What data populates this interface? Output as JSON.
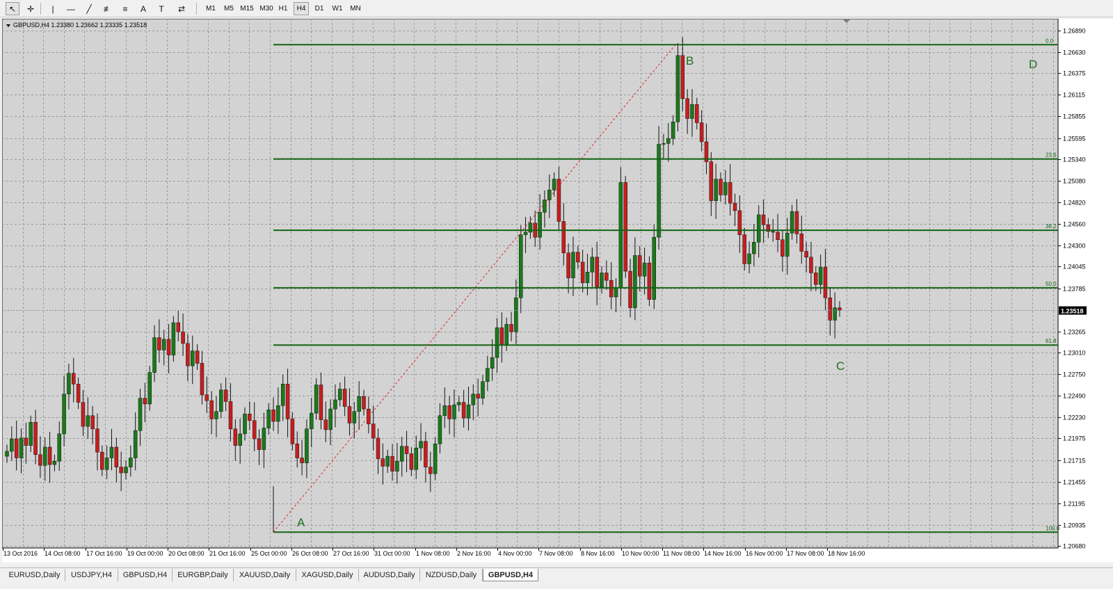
{
  "toolbar": {
    "tools": [
      {
        "name": "cursor-icon",
        "glyph": "↖"
      },
      {
        "name": "crosshair-icon",
        "glyph": "✛"
      },
      {
        "name": "vertical-line-icon",
        "glyph": "|"
      },
      {
        "name": "horizontal-line-icon",
        "glyph": "—"
      },
      {
        "name": "trendline-icon",
        "glyph": "╱"
      },
      {
        "name": "equidistant-channel-icon",
        "glyph": "≢"
      },
      {
        "name": "fibonacci-icon",
        "glyph": "≡"
      },
      {
        "name": "text-icon",
        "glyph": "A"
      },
      {
        "name": "text-label-icon",
        "glyph": "T"
      },
      {
        "name": "arrows-icon",
        "glyph": "⇄"
      }
    ],
    "timeframes": [
      "M1",
      "M5",
      "M15",
      "M30",
      "H1",
      "H4",
      "D1",
      "W1",
      "MN"
    ],
    "selected_timeframe": "H4"
  },
  "chart": {
    "header": "GBPUSD,H4  1.23380 1.23662 1.23335 1.23518",
    "current_price": "1.23518",
    "price_axis": [
      "1.26890",
      "1.26630",
      "1.26375",
      "1.26115",
      "1.25855",
      "1.25595",
      "1.25340",
      "1.25080",
      "1.24820",
      "1.24560",
      "1.24300",
      "1.24045",
      "1.23785",
      "1.23265",
      "1.23010",
      "1.22750",
      "1.22490",
      "1.22230",
      "1.21975",
      "1.21715",
      "1.21455",
      "1.21195",
      "1.20935",
      "1.20680"
    ],
    "time_axis": [
      "13 Oct 2016",
      "14 Oct 08:00",
      "17 Oct 16:00",
      "19 Oct 00:00",
      "20 Oct 08:00",
      "21 Oct 16:00",
      "25 Oct 00:00",
      "26 Oct 08:00",
      "27 Oct 16:00",
      "31 Oct 00:00",
      "1 Nov 08:00",
      "2 Nov 16:00",
      "4 Nov 00:00",
      "7 Nov 08:00",
      "8 Nov 16:00",
      "10 Nov 00:00",
      "11 Nov 08:00",
      "14 Nov 16:00",
      "16 Nov 00:00",
      "17 Nov 08:00",
      "18 Nov 16:00"
    ],
    "fib_labels": [
      "0.0",
      "23.6",
      "38.2",
      "50.0",
      "61.8",
      "100.0"
    ],
    "wave_labels": [
      "A",
      "B",
      "C",
      "D"
    ],
    "colors": {
      "background": "#d3d3d3",
      "grid": "#9a9aa0",
      "bull": "#1a7a1a",
      "bear": "#c81e1e",
      "fib": "#146414",
      "label": "#1e6e1e"
    }
  },
  "tabs": [
    "EURUSD,Daily",
    "USDJPY,H4",
    "GBPUSD,H4",
    "EURGBP,Daily",
    "XAUUSD,Daily",
    "XAGUSD,Daily",
    "AUDUSD,Daily",
    "NZDUSD,Daily",
    "GBPUSD,H4"
  ],
  "active_tab": 8
}
